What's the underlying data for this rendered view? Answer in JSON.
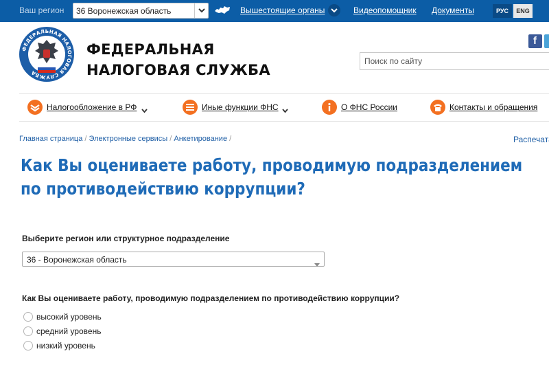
{
  "topbar": {
    "region_label": "Ваш регион",
    "region_value": "36 Воронежская область",
    "links": {
      "higher_bodies": "Вышестоящие органы",
      "video_help": "Видеопомощник",
      "documents": "Документы"
    },
    "lang_ru": "РУС",
    "lang_en": "ENG"
  },
  "header": {
    "brand_line1": "ФЕДЕРАЛЬНАЯ",
    "brand_line2": "НАЛОГОВАЯ СЛУЖБА",
    "logo_ring_text": "ФЕДЕРАЛЬНАЯ НАЛОГОВАЯ СЛУЖБА",
    "search_placeholder": "Поиск по сайту"
  },
  "nav": {
    "taxation": "Налогообложение в РФ",
    "other_functions": "Иные функции ФНС",
    "about": "О ФНС России",
    "contacts": "Контакты и обращения"
  },
  "breadcrumbs": {
    "home": "Главная страница",
    "services": "Электронные сервисы",
    "survey": "Анкетирование",
    "sep": "/",
    "print": "Распечатать"
  },
  "page": {
    "title_line1": "Как Вы оцениваете работу, проводимую подразделением",
    "title_line2": "по противодействию коррупции?"
  },
  "form": {
    "region_label": "Выберите регион или структурное подразделение",
    "region_value": "36 - Воронежская область",
    "question": "Как Вы оцениваете работу, проводимую подразделением по противодействию коррупции?",
    "options": [
      "высокий уровень",
      "средний уровень",
      "низкий уровень"
    ]
  },
  "colors": {
    "topbar_bg": "#0c5da6",
    "title_blue": "#1f6bb7",
    "link_blue": "#1f5fa6",
    "nav_icon_orange": "#f37021"
  }
}
